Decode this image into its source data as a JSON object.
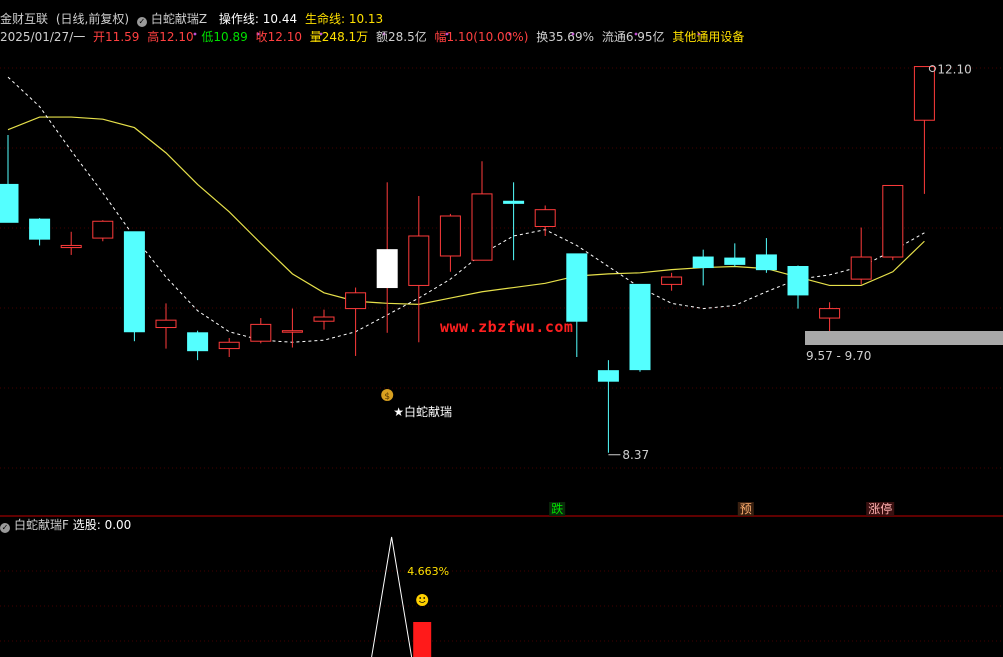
{
  "header": {
    "app_name": "金财互联",
    "period_label": "(日线,前复权)",
    "indicator_name": "白蛇献瑞Z",
    "operation_line_label": "操作线: 10.44",
    "life_line_label": "生命线: 10.13",
    "date": "2025/01/27/一",
    "open_label": "开11.59",
    "high_label": "高12.10",
    "low_label": "低10.89",
    "close_label": "收12.10",
    "volume_label": "量248.1万",
    "amount_label": "额28.5亿",
    "change_label": "幅1.10(10.00%)",
    "turnover_label": "换35.69%",
    "float_label": "流通6.95亿",
    "sector_label": "其他通用设备"
  },
  "sub_header": {
    "indicator_name": "白蛇献瑞F",
    "select_label": "选股: 0.00"
  },
  "annotations": {
    "signal_text": "★白蛇献瑞",
    "high_price": "12.10",
    "low_price": "8.37",
    "range_text": "9.57 - 9.70",
    "flag_down": "跌",
    "flag_predict": "预",
    "flag_limit_up": "涨停",
    "sub_percent": "4.663%",
    "watermark": "www.zbzfwu.com"
  },
  "colors": {
    "up": "#ff3b3b",
    "down": "#54ffff",
    "highlight_candle": "#ffffff",
    "ma_line": "#e6e04a",
    "dash_line": "#ffffff",
    "grid": "#8a0000",
    "divider": "#c00000",
    "text_gray": "#cfcfcf",
    "text_yellow": "#ffe000",
    "text_red": "#ff4040",
    "text_green": "#00e000"
  },
  "chart_data": {
    "type": "candlestick",
    "y_range": [
      8.0,
      12.4
    ],
    "candles": [
      {
        "o": 10.98,
        "h": 11.45,
        "l": 10.7,
        "c": 10.62
      },
      {
        "o": 10.65,
        "h": 10.66,
        "l": 10.4,
        "c": 10.46
      },
      {
        "o": 10.38,
        "h": 10.53,
        "l": 10.31,
        "c": 10.4
      },
      {
        "o": 10.47,
        "h": 10.64,
        "l": 10.44,
        "c": 10.63
      },
      {
        "o": 10.53,
        "h": 10.53,
        "l": 9.49,
        "c": 9.58
      },
      {
        "o": 9.62,
        "h": 9.85,
        "l": 9.42,
        "c": 9.69
      },
      {
        "o": 9.57,
        "h": 9.59,
        "l": 9.31,
        "c": 9.4
      },
      {
        "o": 9.42,
        "h": 9.52,
        "l": 9.34,
        "c": 9.48
      },
      {
        "o": 9.49,
        "h": 9.71,
        "l": 9.47,
        "c": 9.65
      },
      {
        "o": 9.58,
        "h": 9.8,
        "l": 9.43,
        "c": 9.59
      },
      {
        "o": 9.68,
        "h": 9.79,
        "l": 9.6,
        "c": 9.72
      },
      {
        "o": 9.8,
        "h": 10.0,
        "l": 9.35,
        "c": 9.95
      },
      {
        "o": 10.0,
        "h": 11.0,
        "l": 9.57,
        "c": 10.36
      },
      {
        "o": 10.02,
        "h": 10.87,
        "l": 9.48,
        "c": 10.49
      },
      {
        "o": 10.3,
        "h": 10.7,
        "l": 10.15,
        "c": 10.68
      },
      {
        "o": 10.26,
        "h": 11.2,
        "l": 10.34,
        "c": 10.89
      },
      {
        "o": 10.82,
        "h": 11.0,
        "l": 10.26,
        "c": 10.8
      },
      {
        "o": 10.58,
        "h": 10.78,
        "l": 10.49,
        "c": 10.74
      },
      {
        "o": 10.32,
        "h": 10.32,
        "l": 9.34,
        "c": 9.68
      },
      {
        "o": 9.21,
        "h": 9.31,
        "l": 8.43,
        "c": 9.11
      },
      {
        "o": 10.03,
        "h": 10.03,
        "l": 9.2,
        "c": 9.22
      },
      {
        "o": 10.03,
        "h": 10.14,
        "l": 9.97,
        "c": 10.1
      },
      {
        "o": 10.29,
        "h": 10.36,
        "l": 10.02,
        "c": 10.19
      },
      {
        "o": 10.28,
        "h": 10.42,
        "l": 10.2,
        "c": 10.22
      },
      {
        "o": 10.31,
        "h": 10.47,
        "l": 10.14,
        "c": 10.17
      },
      {
        "o": 10.2,
        "h": 10.21,
        "l": 9.8,
        "c": 9.93
      },
      {
        "o": 9.71,
        "h": 9.86,
        "l": 9.56,
        "c": 9.8
      },
      {
        "o": 10.08,
        "h": 10.57,
        "l": 10.03,
        "c": 10.29
      },
      {
        "o": 10.29,
        "h": 10.97,
        "l": 10.26,
        "c": 10.97
      },
      {
        "o": 11.59,
        "h": 12.1,
        "l": 10.89,
        "c": 12.1
      }
    ],
    "solid_line": [
      11.5,
      11.62,
      11.62,
      11.6,
      11.52,
      11.28,
      10.98,
      10.72,
      10.42,
      10.13,
      9.95,
      9.87,
      9.85,
      9.84,
      9.9,
      9.96,
      10.0,
      10.04,
      10.11,
      10.13,
      10.14,
      10.17,
      10.19,
      10.2,
      10.18,
      10.1,
      10.02,
      10.02,
      10.15,
      10.44
    ],
    "dashed_line": [
      12.0,
      11.72,
      11.3,
      10.9,
      10.48,
      10.1,
      9.78,
      9.58,
      9.5,
      9.48,
      9.5,
      9.58,
      9.74,
      9.9,
      10.08,
      10.32,
      10.49,
      10.55,
      10.4,
      10.2,
      10.0,
      9.85,
      9.8,
      9.83,
      9.96,
      10.08,
      10.12,
      10.2,
      10.35,
      10.52
    ],
    "sub_chart": {
      "bar_value": 4.663,
      "triangle_peak_index": 11,
      "bar_index": 12
    }
  }
}
